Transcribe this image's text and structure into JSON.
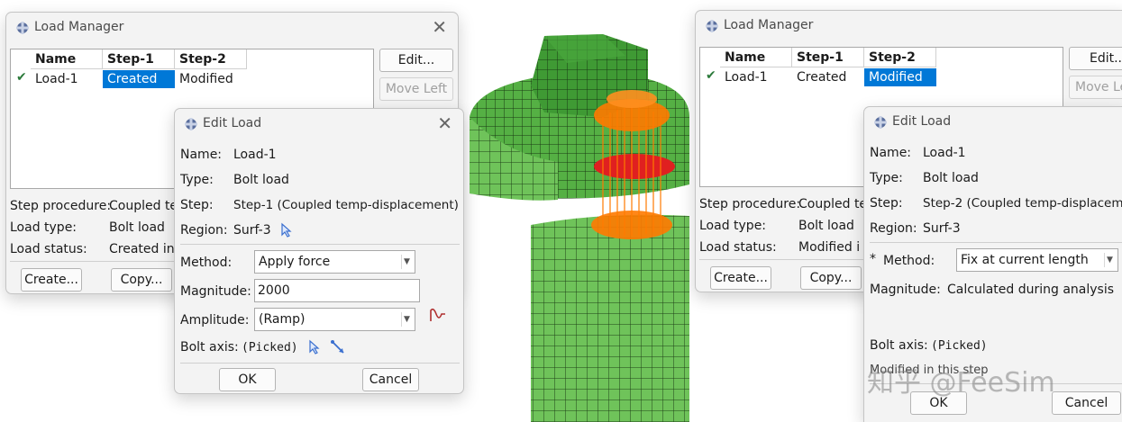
{
  "left_manager": {
    "title": "Load Manager",
    "columns": [
      "Name",
      "Step-1",
      "Step-2"
    ],
    "row": {
      "name": "Load-1",
      "step1": "Created",
      "step2": "Modified"
    },
    "selected_column": "Step-1",
    "buttons": {
      "edit": "Edit...",
      "move_left": "Move Left",
      "create": "Create...",
      "copy": "Copy..."
    },
    "info": {
      "step_procedure_label": "Step procedure:",
      "step_procedure_value": "Coupled te",
      "load_type_label": "Load type:",
      "load_type_value": "Bolt load",
      "load_status_label": "Load status:",
      "load_status_value": "Created in"
    }
  },
  "left_edit": {
    "title": "Edit Load",
    "name_label": "Name:",
    "name_value": "Load-1",
    "type_label": "Type:",
    "type_value": "Bolt load",
    "step_label": "Step:",
    "step_value": "Step-1 (Coupled temp-displacement)",
    "region_label": "Region:",
    "region_value": "Surf-3",
    "method_label": "Method:",
    "method_value": "Apply force",
    "magnitude_label": "Magnitude:",
    "magnitude_value": "2000",
    "amplitude_label": "Amplitude:",
    "amplitude_value": "(Ramp)",
    "bolt_axis_label": "Bolt axis:",
    "bolt_axis_value": "(Picked)",
    "ok": "OK",
    "cancel": "Cancel"
  },
  "right_manager": {
    "title": "Load Manager",
    "columns": [
      "Name",
      "Step-1",
      "Step-2"
    ],
    "row": {
      "name": "Load-1",
      "step1": "Created",
      "step2": "Modified"
    },
    "selected_column": "Step-2",
    "buttons": {
      "edit": "Edit...",
      "move_left": "Move Le",
      "create": "Create...",
      "copy": "Copy..."
    },
    "info": {
      "step_procedure_label": "Step procedure:",
      "step_procedure_value": "Coupled te",
      "load_type_label": "Load type:",
      "load_type_value": "Bolt load",
      "load_status_label": "Load status:",
      "load_status_value": "Modified i"
    }
  },
  "right_edit": {
    "title": "Edit Load",
    "name_label": "Name:",
    "name_value": "Load-1",
    "type_label": "Type:",
    "type_value": "Bolt load",
    "step_label": "Step:",
    "step_value": "Step-2 (Coupled temp-displacem",
    "region_label": "Region:",
    "region_value": "Surf-3",
    "method_marker": "*",
    "method_label": "Method:",
    "method_value": "Fix at current length",
    "magnitude_label": "Magnitude:",
    "magnitude_value": "Calculated during analysis",
    "bolt_axis_label": "Bolt axis:",
    "bolt_axis_value": "(Picked)",
    "modified_note": "Modified in this step",
    "ok": "OK",
    "cancel": "Cancel"
  },
  "watermark": "知乎 @FeeSim",
  "colors": {
    "selection": "#0078d7",
    "mesh_green": "#4fae3c",
    "load_arrows": "#ff7a00"
  }
}
